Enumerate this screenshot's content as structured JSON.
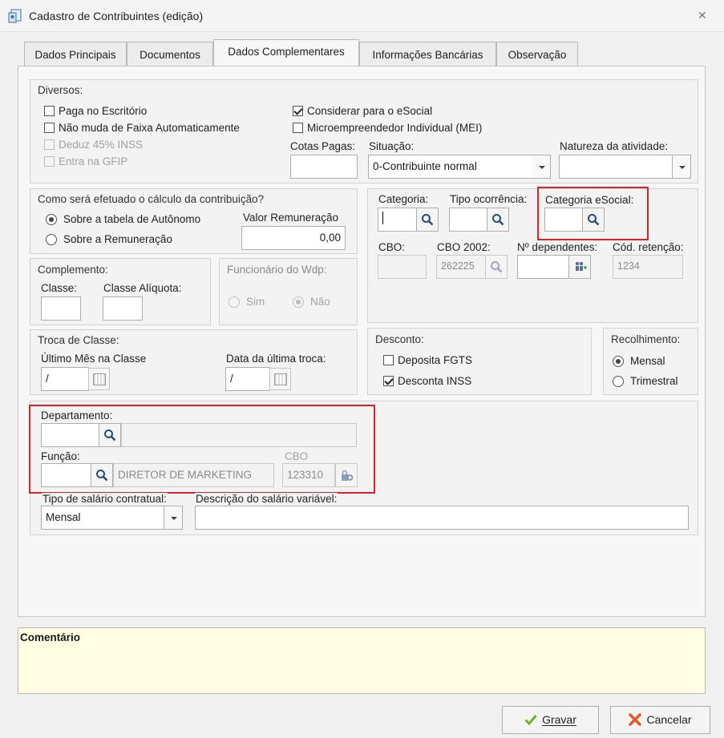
{
  "window": {
    "title": "Cadastro de Contribuintes (edição)"
  },
  "tabs": [
    "Dados Principais",
    "Documentos",
    "Dados Complementares",
    "Informações Bancárias",
    "Observação"
  ],
  "diversos": {
    "title": "Diversos:",
    "paga_escritorio": "Paga no Escritório",
    "nao_muda_faixa": "Não muda de Faixa Automaticamente",
    "deduz_inss": "Deduz 45% INSS",
    "entra_gfip": "Entra na GFIP",
    "considerar_esocial": "Considerar para o eSocial",
    "mei": "Microempreendedor Individual (MEI)",
    "cotas_label": "Cotas Pagas:",
    "situacao_label": "Situação:",
    "situacao_value": "0-Contribuinte normal",
    "natureza_label": "Natureza da atividade:"
  },
  "calculo": {
    "title": "Como será efetuado o cálculo da contribuição?",
    "opt_autonomo": "Sobre a tabela de Autônomo",
    "opt_remuneracao": "Sobre a Remuneração",
    "valor_label": "Valor Remuneração",
    "valor": "0,00"
  },
  "categoria": {
    "categoria_label": "Categoria:",
    "tipo_ocorrencia_label": "Tipo ocorrência:",
    "categoria_esocial_label": "Categoria eSocial:",
    "cbo_label": "CBO:",
    "cbo2002_label": "CBO 2002:",
    "cbo2002_value": "262225",
    "dependentes_label": "Nº dependentes:",
    "cod_retencao_label": "Cód. retenção:",
    "cod_retencao_value": "1234"
  },
  "complemento": {
    "title": "Complemento:",
    "classe_label": "Classe:",
    "aliquota_label": "Classe Alíquota:"
  },
  "funcionario": {
    "title": "Funcionário do Wdp:",
    "sim": "Sim",
    "nao": "Não"
  },
  "troca": {
    "title": "Troca de Classe:",
    "ultimo_label": "Último Mês na Classe",
    "ultimo_value": "/",
    "data_label": "Data da última troca:",
    "data_value": "/"
  },
  "desconto": {
    "title": "Desconto:",
    "fgts": "Deposita FGTS",
    "inss": "Desconta INSS"
  },
  "recolhimento": {
    "title": "Recolhimento:",
    "mensal": "Mensal",
    "trimestral": "Trimestral"
  },
  "departamento": {
    "label": "Departamento:",
    "funcao_label": "Função:",
    "funcao_desc": "DIRETOR DE MARKETING",
    "cbo_label": "CBO",
    "cbo_value": "123310"
  },
  "salario": {
    "tipo_label": "Tipo de salário contratual:",
    "tipo_value": "Mensal",
    "desc_label": "Descrição do salário variável:"
  },
  "comentario": {
    "label": "Comentário"
  },
  "buttons": {
    "gravar": "Gravar",
    "cancelar": "Cancelar"
  },
  "colors": {
    "highlight": "#d7232e",
    "comment_bg": "#fffee3"
  }
}
